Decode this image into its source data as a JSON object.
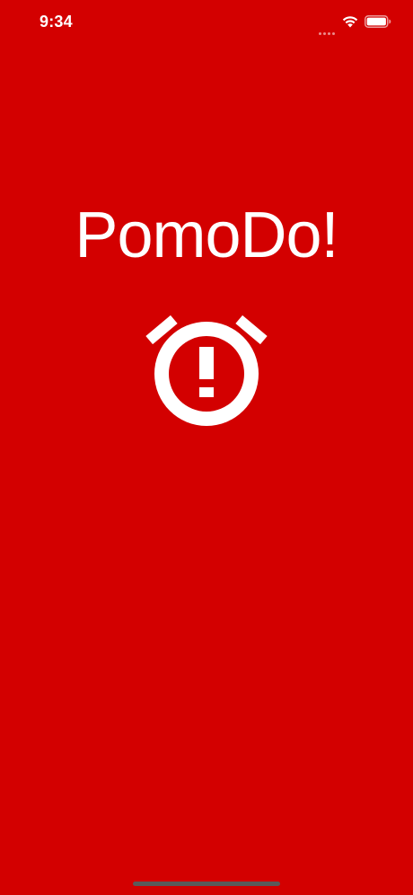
{
  "status_bar": {
    "time": "9:34",
    "icons": [
      "cellular-signal-icon",
      "wifi-icon",
      "battery-icon"
    ]
  },
  "splash": {
    "title": "PomoDo!",
    "logo_icon": "alarm-clock-alert-icon"
  },
  "colors": {
    "background": "#d30000",
    "foreground": "#ffffff",
    "home_indicator": "#5a5a5a"
  }
}
